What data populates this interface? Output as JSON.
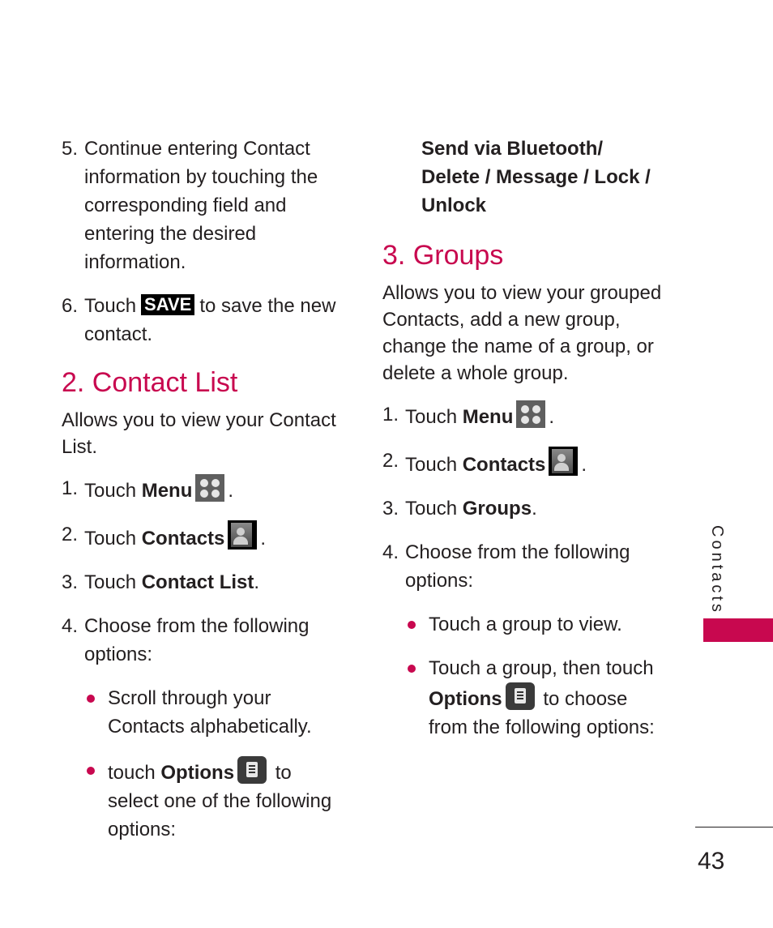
{
  "left_column": {
    "step5": {
      "num": "5.",
      "text": "Continue entering Contact information by touching the corresponding field and entering the desired information."
    },
    "step6": {
      "num": "6.",
      "pre": "Touch",
      "badge": "SAVE",
      "post": "to save the new contact."
    },
    "section2": {
      "title": "2. Contact List",
      "intro": "Allows you to view your Contact List.",
      "steps": [
        {
          "num": "1.",
          "pre": "Touch",
          "bold": "Menu",
          "post": "."
        },
        {
          "num": "2.",
          "pre": "Touch",
          "bold": "Contacts",
          "post": "."
        },
        {
          "num": "3.",
          "pre": "Touch",
          "bold": "Contact List",
          "post": "."
        },
        {
          "num": "4.",
          "text": "Choose from the following options:"
        }
      ],
      "bullets": [
        {
          "text": "Scroll through your Contacts alphabetically."
        },
        {
          "pre": "touch",
          "bold": "Options",
          "post": "to select one of the following options:"
        }
      ]
    }
  },
  "right_column": {
    "continued_options": "Send via Bluetooth/ Delete / Message / Lock / Unlock",
    "section3": {
      "title": "3. Groups",
      "intro": "Allows you to view your grouped Contacts, add a new group, change the name of a group, or delete a whole group.",
      "steps": [
        {
          "num": "1.",
          "pre": "Touch",
          "bold": "Menu",
          "post": "."
        },
        {
          "num": "2.",
          "pre": "Touch",
          "bold": "Contacts",
          "post": "."
        },
        {
          "num": "3.",
          "pre": "Touch",
          "bold": "Groups",
          "post": "."
        },
        {
          "num": "4.",
          "text": "Choose from the following options:"
        }
      ],
      "bullets": [
        {
          "text": "Touch a group to view."
        },
        {
          "pre": "Touch a group, then touch",
          "bold": "Options",
          "post": "to choose from the following options:"
        }
      ]
    }
  },
  "side_tab": {
    "label": "Contacts",
    "color": "#c8084f"
  },
  "page_number": "43",
  "accent_color": "#c8084f"
}
